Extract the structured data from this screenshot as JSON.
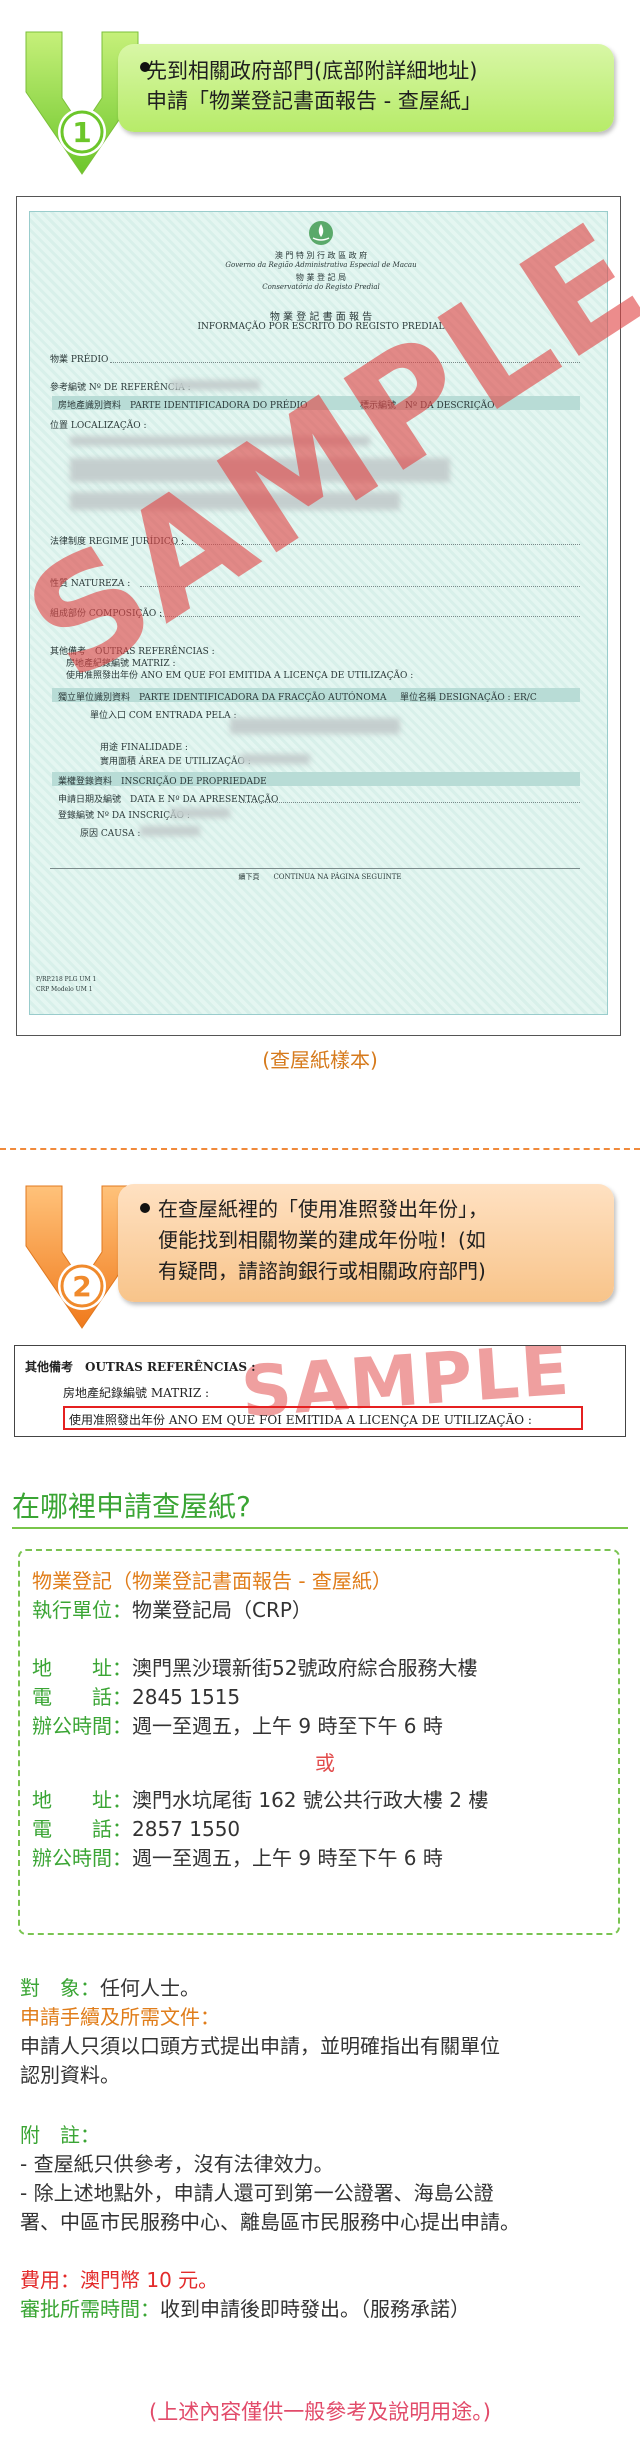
{
  "step1": {
    "number": "1",
    "line1": "先到相關政府部門(底部附詳細地址)",
    "line2": "申請「物業登記書面報告 - 查屋紙」"
  },
  "doc": {
    "emblem_title_zh": "澳 門 特 別 行 政 區 政 府",
    "emblem_title_pt": "Governo da Região Administrativa Especial de Macau",
    "bureau_zh": "物 業 登 記 局",
    "bureau_pt": "Conservatória do Registo Predial",
    "form_title_zh": "物 業 登 記 書 面 報 告",
    "form_title_pt": "INFORMAÇÃO POR ESCRITO DO REGISTO PREDIAL",
    "fields": {
      "predio": "物業 PRÉDIO",
      "referencia": "參考編號 Nº DE REFERÊNCIA :",
      "parte_id": "房地產識別資料　PARTE IDENTIFICADORA DO PRÉDIO",
      "descricao": "標示編號　Nº DA DESCRIÇÃO",
      "localizacao": "位置 LOCALIZAÇÃO :",
      "regime": "法律制度 REGIME JURÍDICO :",
      "natureza": "性質 NATUREZA :",
      "composicao": "組成部份 COMPOSIÇÃO :",
      "outras": "其他備考　OUTRAS REFERÊNCIAS :",
      "matriz": "房地產紀錄編號 MATRIZ :",
      "ano_licenca": "使用准照發出年份 ANO EM QUE FOI EMITIDA A LICENÇA DE UTILIZAÇÃO :",
      "fraccao": "獨立單位識別資料　PARTE IDENTIFICADORA DA FRACÇÃO AUTÓNOMA",
      "designacao": "單位名稱 DESIGNAÇÃO : ER/C",
      "entrada": "單位入口 COM ENTRADA PELA :",
      "finalidade": "用途 FINALIDADE :",
      "area": "實用面積 ÁREA DE UTILIZAÇÃO :",
      "propriedade": "業權登錄資料　INSCRIÇÃO DE PROPRIEDADE",
      "data_apresentacao": "申請日期及編號　DATA E Nº DA APRESENTAÇÃO",
      "inscricao": "登錄編號 Nº DA INSCRIÇÃO :",
      "causa": "原因 CAUSA :",
      "continua": "續下頁　　CONTINUA NA PÁGINA SEGUINTE",
      "footer_code1": "P/RP.218  PLG  UM 1",
      "footer_code2": "CRP  Modelo  UM 1"
    },
    "watermark": "SAMPLE"
  },
  "caption1": "(查屋紙樣本)",
  "step2": {
    "number": "2",
    "line1": "在查屋紙裡的「使用准照發出年份」，",
    "line2": "便能找到相關物業的建成年份啦！(如",
    "line3": "有疑問，請諮詢銀行或相關政府部門)"
  },
  "excerpt": {
    "line1": "其他備考　OUTRAS REFERÊNCIAS :",
    "line2": "房地產紀錄編號 MATRIZ :",
    "line3": "使用准照發出年份 ANO EM QUE FOI EMITIDA A LICENÇA DE UTILIZAÇÃO :",
    "watermark": "SAMPLE"
  },
  "where": {
    "title": "在哪裡申請查屋紙?",
    "service_title": "物業登記（物業登記書面報告 - 查屋紙）",
    "exec_label": "執行單位：",
    "exec_value": "物業登記局（CRP）",
    "addr_label": "地　　址：",
    "addr1": "澳門黑沙環新街52號政府綜合服務大樓",
    "tel_label": "電　　話：",
    "tel1": "2845 1515",
    "hours_label": "辦公時間：",
    "hours1": "週一至週五，上午 9 時至下午 6 時",
    "or": "或",
    "addr2": "澳門水坑尾街 162 號公共行政大樓 2 樓",
    "tel2": "2857 1550",
    "hours2": "週一至週五，上午 9 時至下午 6 時"
  },
  "details": {
    "target_label": "對　象：",
    "target_value": "任何人士。",
    "procedure_label": "申請手續及所需文件：",
    "procedure_line1": "申請人只須以口頭方式提出申請，並明確指出有關單位",
    "procedure_line2": "認別資料。",
    "notes_label": "附　註：",
    "note1": "- 查屋紙只供參考，沒有法律效力。",
    "note2_line1": "- 除上述地點外，申請人還可到第一公證署、海島公證",
    "note2_line2": "署、中區市民服務中心、離島區市民服務中心提出申請。",
    "fee_label": "費用：",
    "fee_value": "澳門幣 10 元。",
    "time_label": "審批所需時間：",
    "time_value": "收到申請後即時發出。（服務承諾）"
  },
  "footer": "(上述內容僅供一般參考及說明用途。)"
}
